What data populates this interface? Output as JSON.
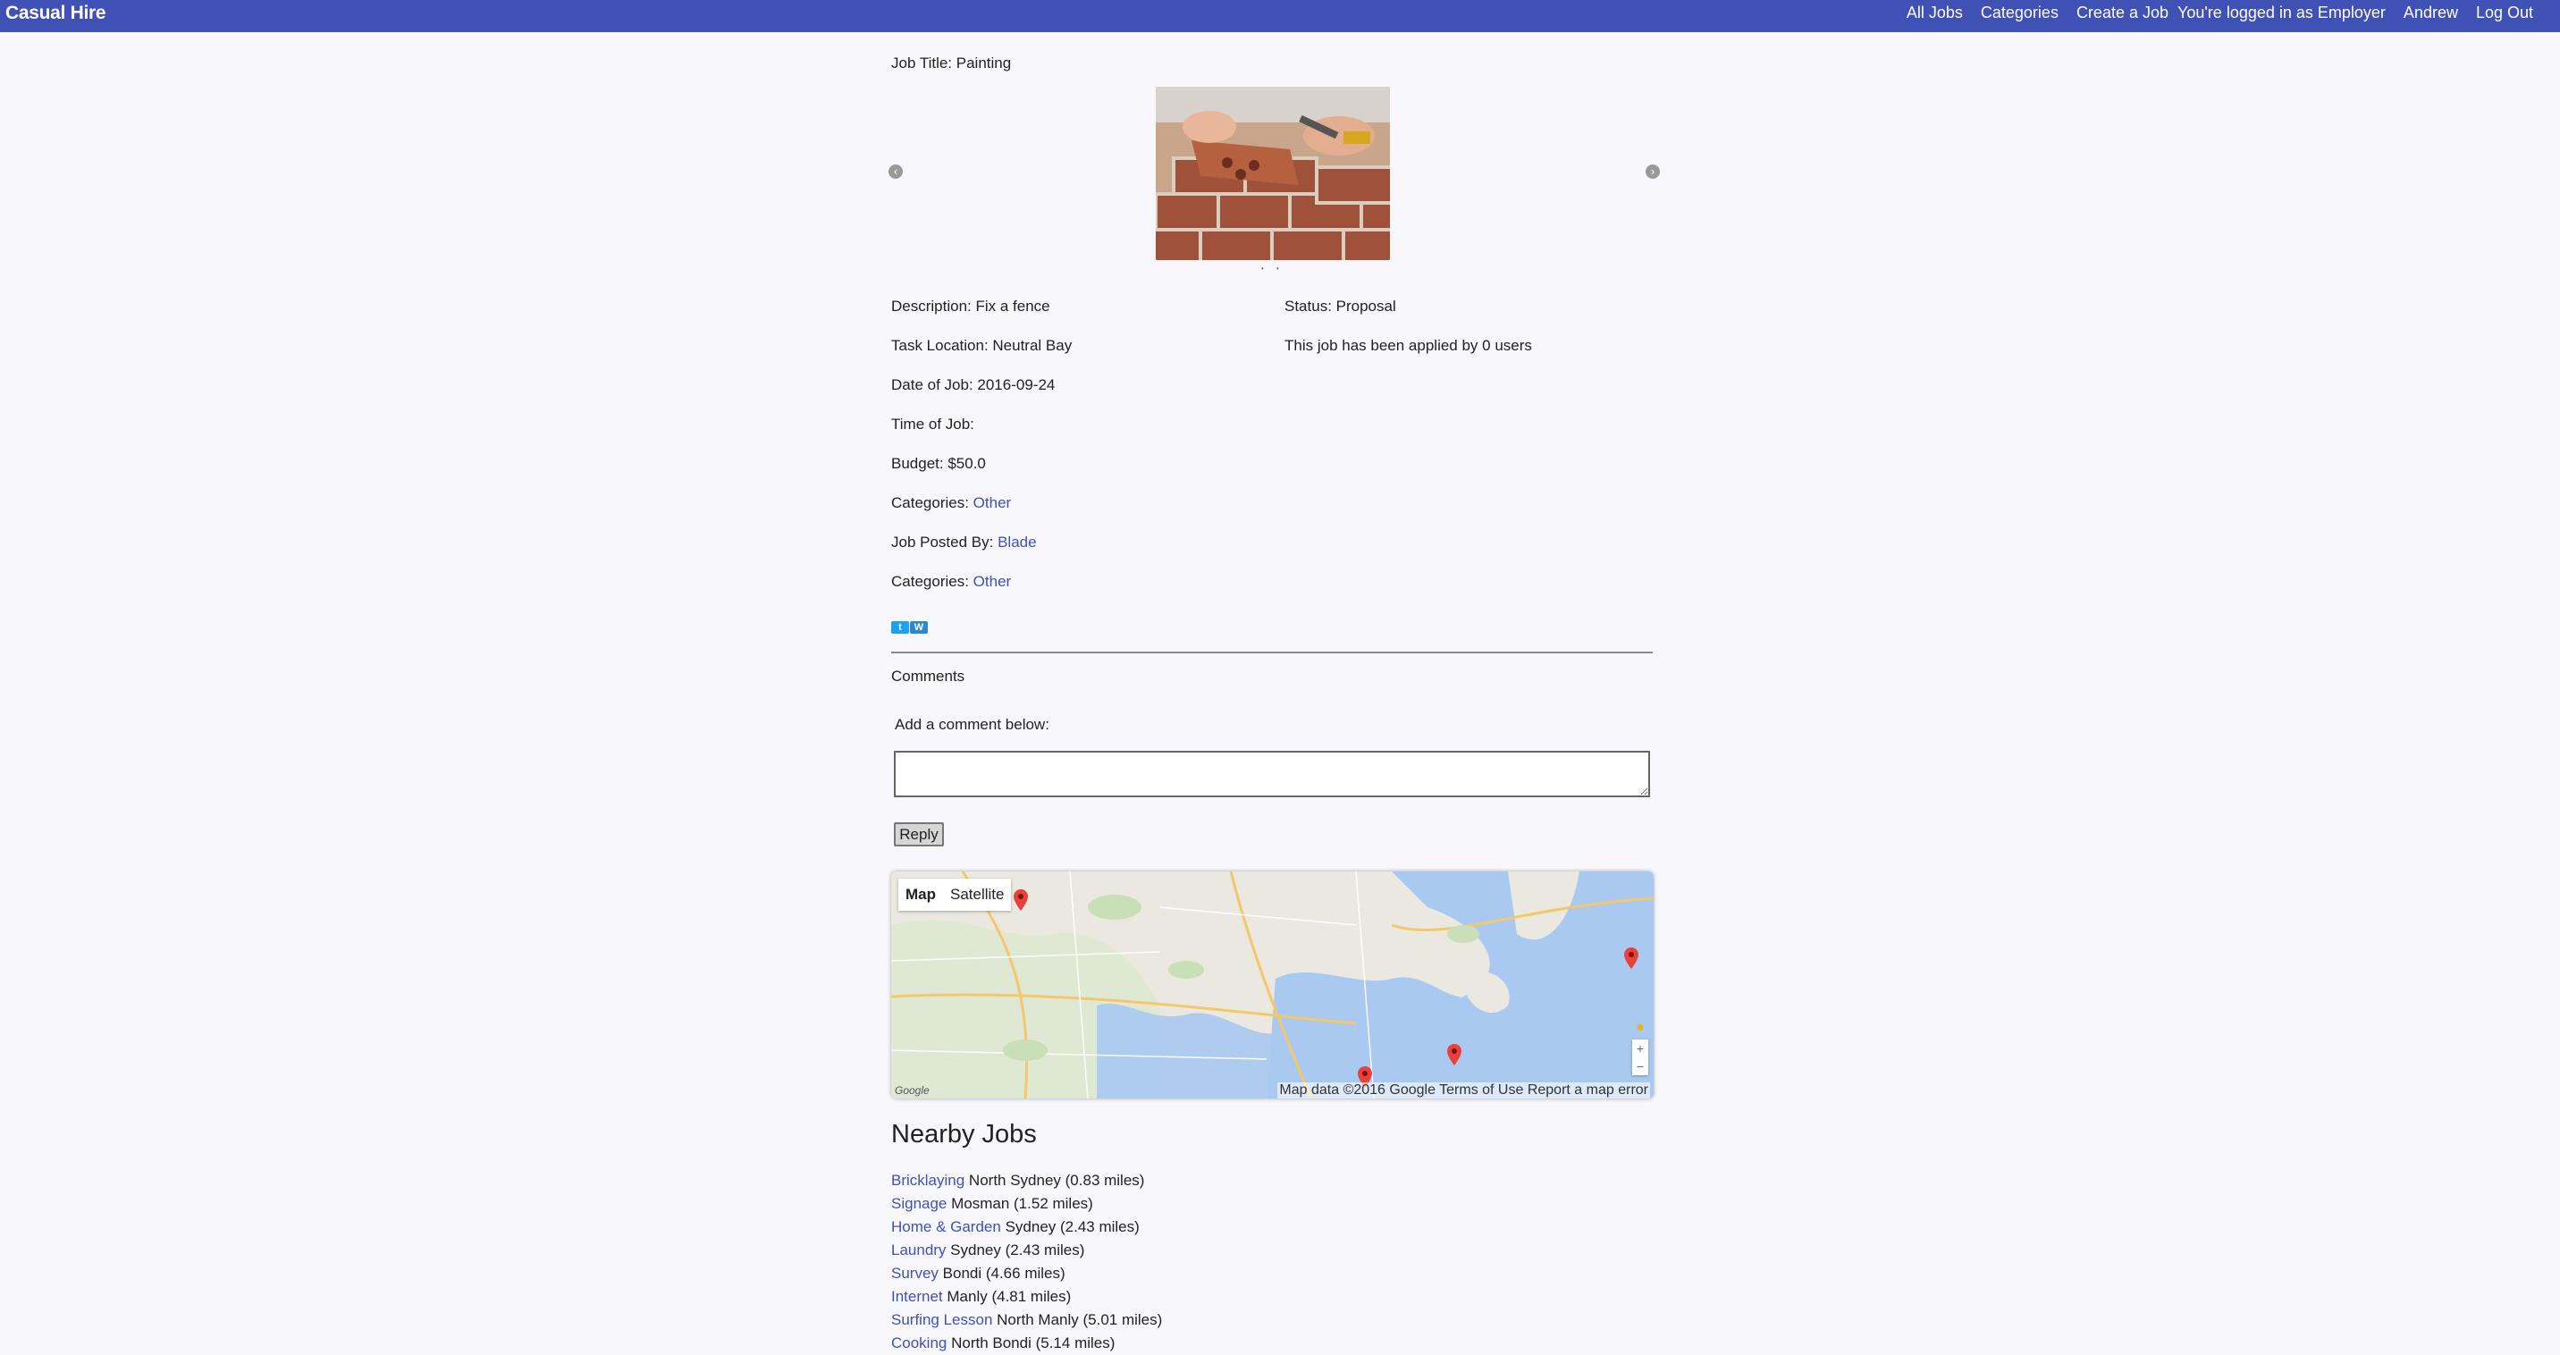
{
  "header": {
    "brand": "Casual Hire",
    "nav": [
      "All Jobs",
      "Categories",
      "Create a Job",
      "You're logged in as Employer",
      "Andrew",
      "Log Out"
    ]
  },
  "job": {
    "title_label": "Job Title: Painting",
    "description": "Description: Fix a fence",
    "status": "Status: Proposal",
    "location": "Task Location: Neutral Bay",
    "applied": "This job has been applied by 0 users",
    "date": "Date of Job: 2016-09-24",
    "time": "Time of Job:",
    "budget": "Budget: $50.0",
    "categories_label": "Categories: ",
    "category_link": "Other",
    "posted_by_label": "Job Posted By: ",
    "posted_by_link": "Blade",
    "categories2_label": "Categories: ",
    "category2_link": "Other"
  },
  "share": {
    "twitter": "t",
    "other": "W"
  },
  "comments": {
    "heading": "Comments",
    "prompt": "Add a comment below:",
    "textarea_value": "",
    "reply_label": "Reply"
  },
  "map": {
    "type_map": "Map",
    "type_satellite": "Satellite",
    "attribution": "Map data ©2016 Google  Terms of Use  Report a map error",
    "google_logo": "Google",
    "zoom_in": "+",
    "zoom_out": "−"
  },
  "nearby": {
    "title": "Nearby Jobs",
    "items": [
      {
        "link": "Bricklaying",
        "text": " North Sydney (0.83 miles)"
      },
      {
        "link": "Signage",
        "text": " Mosman (1.52 miles)"
      },
      {
        "link": "Home & Garden",
        "text": " Sydney (2.43 miles)"
      },
      {
        "link": "Laundry",
        "text": " Sydney (2.43 miles)"
      },
      {
        "link": "Survey",
        "text": " Bondi (4.66 miles)"
      },
      {
        "link": "Internet",
        "text": " Manly (4.81 miles)"
      },
      {
        "link": "Surfing Lesson",
        "text": " North Manly (5.01 miles)"
      },
      {
        "link": "Cooking",
        "text": " North Bondi (5.14 miles)"
      }
    ]
  }
}
